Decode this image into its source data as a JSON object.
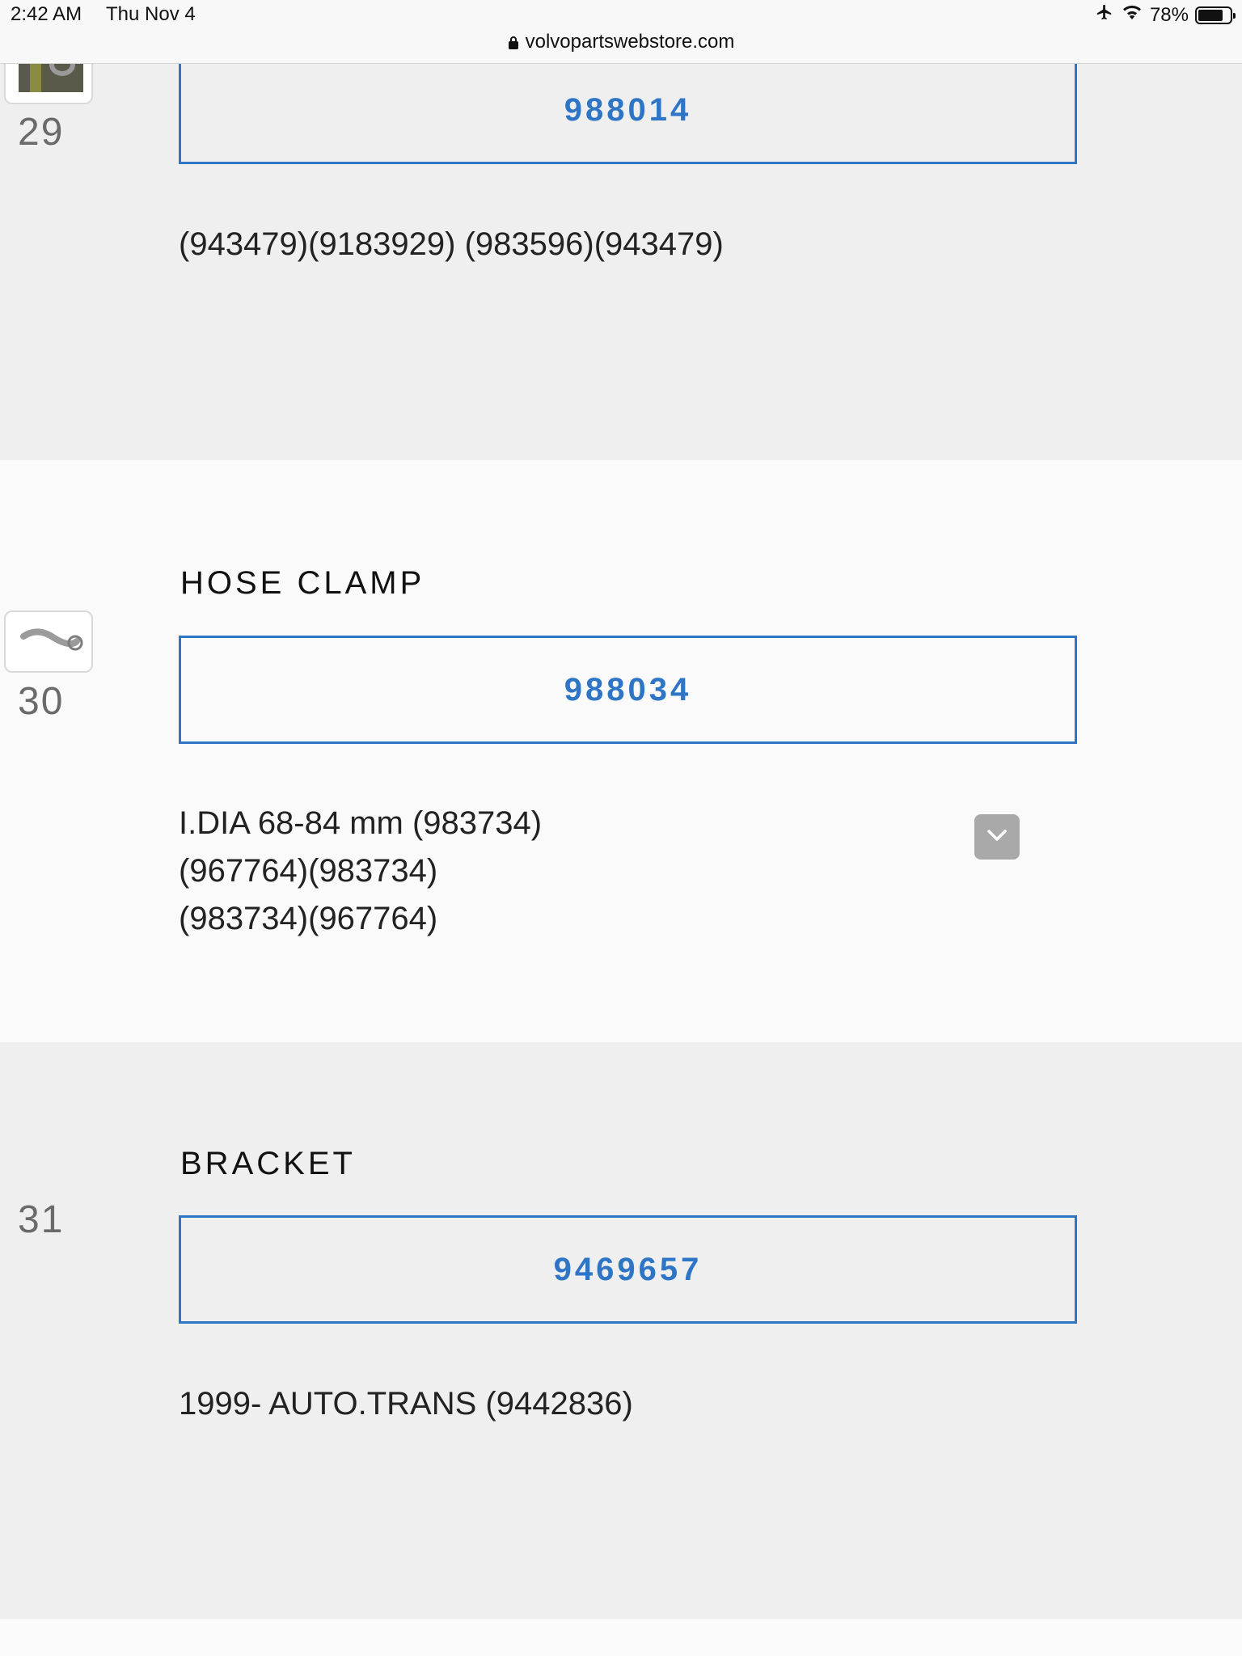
{
  "status_bar": {
    "time": "2:42 AM",
    "date": "Thu Nov 4",
    "battery": "78%",
    "battery_level": 0.78,
    "airplane_icon": "airplane-icon",
    "wifi_icon": "wifi-icon"
  },
  "address_bar": {
    "url": "volvopartswebstore.com",
    "lock_icon": "lock-icon"
  },
  "accent_color": "#2f75c6",
  "parts": [
    {
      "number": "29",
      "title": "",
      "part_no": "988014",
      "notes": [
        "(943479)(9183929) (983596)(943479)"
      ]
    },
    {
      "number": "30",
      "title": "HOSE CLAMP",
      "part_no": "988034",
      "notes": [
        "I.DIA 68-84 mm (983734)",
        "(967764)(983734)",
        "(983734)(967764)"
      ],
      "expand_icon": "chevron-down-icon"
    },
    {
      "number": "31",
      "title": "BRACKET",
      "part_no": "9469657",
      "notes": [
        "1999- AUTO.TRANS (9442836)"
      ]
    }
  ]
}
